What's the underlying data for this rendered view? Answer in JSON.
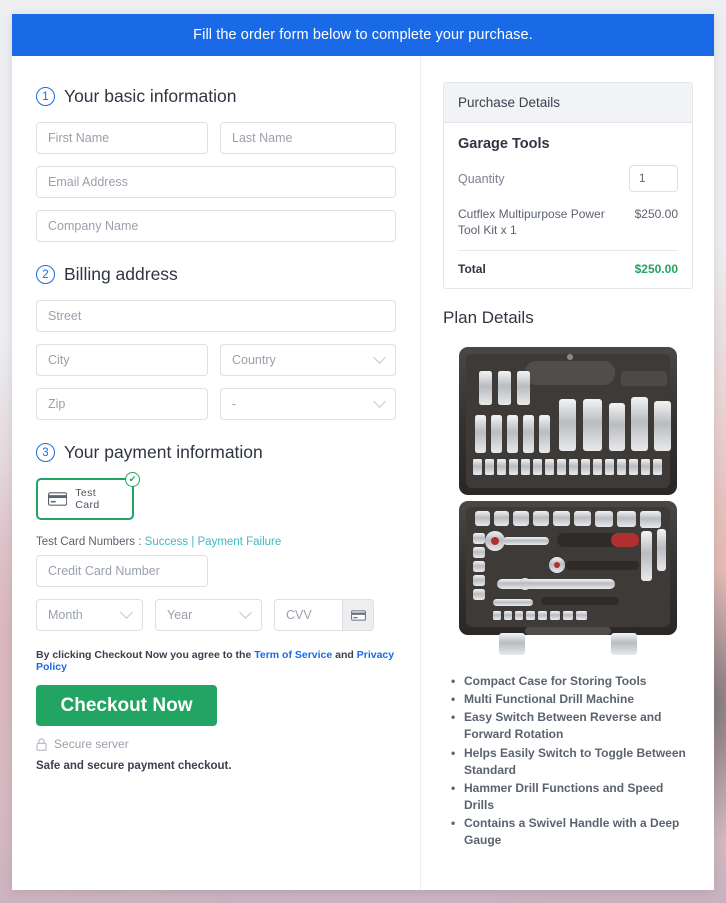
{
  "banner": {
    "text": "Fill the order form below to complete your purchase."
  },
  "steps": [
    {
      "num": "1",
      "title": "Your basic information"
    },
    {
      "num": "2",
      "title": "Billing address"
    },
    {
      "num": "3",
      "title": "Your payment information"
    }
  ],
  "basic_info": {
    "first_name_placeholder": "First Name",
    "last_name_placeholder": "Last Name",
    "email_placeholder": "Email Address",
    "company_placeholder": "Company Name"
  },
  "billing": {
    "street_placeholder": "Street",
    "city_placeholder": "City",
    "country_placeholder": "Country",
    "zip_placeholder": "Zip",
    "state_placeholder": "-"
  },
  "payment": {
    "method_label": "Test Card",
    "method_icon": "credit-card-icon",
    "selected_badge": "✔",
    "test_numbers_prefix": "Test Card Numbers : ",
    "success_link": "Success",
    "separator": " | ",
    "failure_link": "Payment Failure",
    "card_number_placeholder": "Credit Card Number",
    "month_placeholder": "Month",
    "year_placeholder": "Year",
    "cvv_placeholder": "CVV",
    "cvv_icon": "credit-card-icon"
  },
  "terms": {
    "prefix": "By clicking Checkout Now you agree to the ",
    "tos_link": "Term of Service",
    "middle": " and ",
    "privacy_link": "Privacy Policy"
  },
  "actions": {
    "checkout_label": "Checkout Now",
    "secure_server": "Secure server",
    "lock_icon": "lock-icon",
    "safe_note": "Safe and secure payment checkout."
  },
  "purchase_details": {
    "header": "Purchase Details",
    "product_name": "Garage Tools",
    "quantity_label": "Quantity",
    "quantity_value": "1",
    "line_item": "Cutflex Multipurpose Power Tool Kit x 1",
    "line_price": "$250.00",
    "total_label": "Total",
    "total_value": "$250.00"
  },
  "plan_details": {
    "title": "Plan Details",
    "image_alt": "garage-tool-kit-case",
    "features": [
      "Compact Case for Storing Tools",
      "Multi Functional Drill Machine",
      "Easy Switch Between Reverse and Forward Rotation",
      "Helps Easily Switch to Toggle Between Standard",
      "Hammer Drill Functions and Speed Drills",
      "Contains a Swivel Handle with a Deep Gauge"
    ]
  },
  "colors": {
    "banner_blue": "#1a6ae8",
    "accent_green": "#22a463",
    "link_blue": "#1a6ae8",
    "link_teal": "#3fb8c4"
  }
}
